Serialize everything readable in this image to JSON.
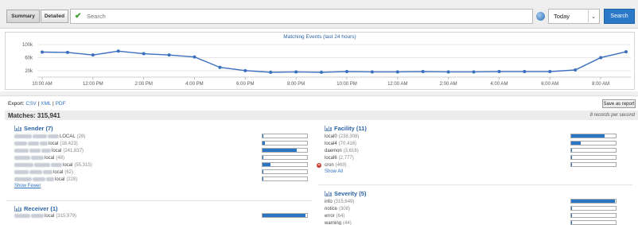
{
  "toolbar": {
    "summary_label": "Summary",
    "detailed_label": "Detailed",
    "search_placeholder": "Search",
    "range_value": "Today",
    "search_button": "Search"
  },
  "chart_data": {
    "type": "line",
    "title": "Matching Events (last 24 hours)",
    "x": [
      "10:00 AM",
      "11:00 AM",
      "12:00 PM",
      "1:00 PM",
      "2:00 PM",
      "3:00 PM",
      "4:00 PM",
      "5:00 PM",
      "6:00 PM",
      "7:00 PM",
      "8:00 PM",
      "9:00 PM",
      "10:00 PM",
      "11:00 PM",
      "12:00 AM",
      "1:00 AM",
      "2:00 AM",
      "3:00 AM",
      "4:00 AM",
      "5:00 AM",
      "6:00 AM",
      "7:00 AM",
      "8:00 AM",
      "9:00 AM"
    ],
    "xticks": [
      "10:00 AM",
      "12:00 PM",
      "2:00 PM",
      "4:00 PM",
      "6:00 PM",
      "8:00 PM",
      "10:00 PM",
      "12:00 AM",
      "2:00 AM",
      "4:00 AM",
      "6:00 AM",
      "8:00 AM"
    ],
    "yticks": [
      "20k",
      "60k",
      "100k"
    ],
    "ylim": [
      0,
      110000
    ],
    "series": [
      {
        "values": [
          77000,
          76000,
          68000,
          80000,
          72000,
          68000,
          62000,
          30000,
          20000,
          15000,
          16000,
          15000,
          17000,
          16000,
          16000,
          17000,
          16000,
          16000,
          17000,
          17000,
          17000,
          22000,
          60000,
          78000
        ]
      }
    ],
    "color": "#3a6fbf",
    "grid": true
  },
  "export": {
    "label": "Export:",
    "csv": "CSV",
    "xml": "XML",
    "pdf": "PDF",
    "sep": "|",
    "save_button": "Save as report"
  },
  "summary": {
    "matches": "Matches: 315,941",
    "rate": "8 records per second"
  },
  "sender": {
    "title": "Sender (7)",
    "items": [
      {
        "suffix": "LOCAL",
        "count": "(28)",
        "fill": 0.0
      },
      {
        "suffix": "local",
        "count": "(18,423)",
        "fill": 0.06
      },
      {
        "suffix": "local",
        "count": "(241,837)",
        "fill": 0.77
      },
      {
        "suffix": "local",
        "count": "(48)",
        "fill": 0.0
      },
      {
        "suffix": "local",
        "count": "(55,315)",
        "fill": 0.18
      },
      {
        "suffix": "local",
        "count": "(62)",
        "fill": 0.0
      },
      {
        "suffix": "local",
        "count": "(228)",
        "fill": 0.0
      }
    ],
    "show_fewer": "Show Fewer"
  },
  "receiver": {
    "title": "Receiver (1)",
    "items": [
      {
        "suffix": "local",
        "count": "(315,979)",
        "fill": 0.97
      }
    ]
  },
  "facility": {
    "title": "Facility (11)",
    "items": [
      {
        "name": "local0",
        "count": "(238,308)",
        "fill": 0.75,
        "excluded": false
      },
      {
        "name": "local4",
        "count": "(70,416)",
        "fill": 0.22,
        "excluded": false
      },
      {
        "name": "daemon",
        "count": "(3,616)",
        "fill": 0.01,
        "excluded": false
      },
      {
        "name": "local6",
        "count": "(2,777)",
        "fill": 0.01,
        "excluded": false
      },
      {
        "name": "cron",
        "count": "(469)",
        "fill": 0.0,
        "excluded": true
      }
    ],
    "show_all": "Show All"
  },
  "severity": {
    "title": "Severity (5)",
    "items": [
      {
        "name": "info",
        "count": "(315,649)",
        "fill": 0.99
      },
      {
        "name": "notice",
        "count": "(308)",
        "fill": 0.0
      },
      {
        "name": "error",
        "count": "(64)",
        "fill": 0.0
      },
      {
        "name": "warning",
        "count": "(44)",
        "fill": 0.0
      }
    ]
  }
}
